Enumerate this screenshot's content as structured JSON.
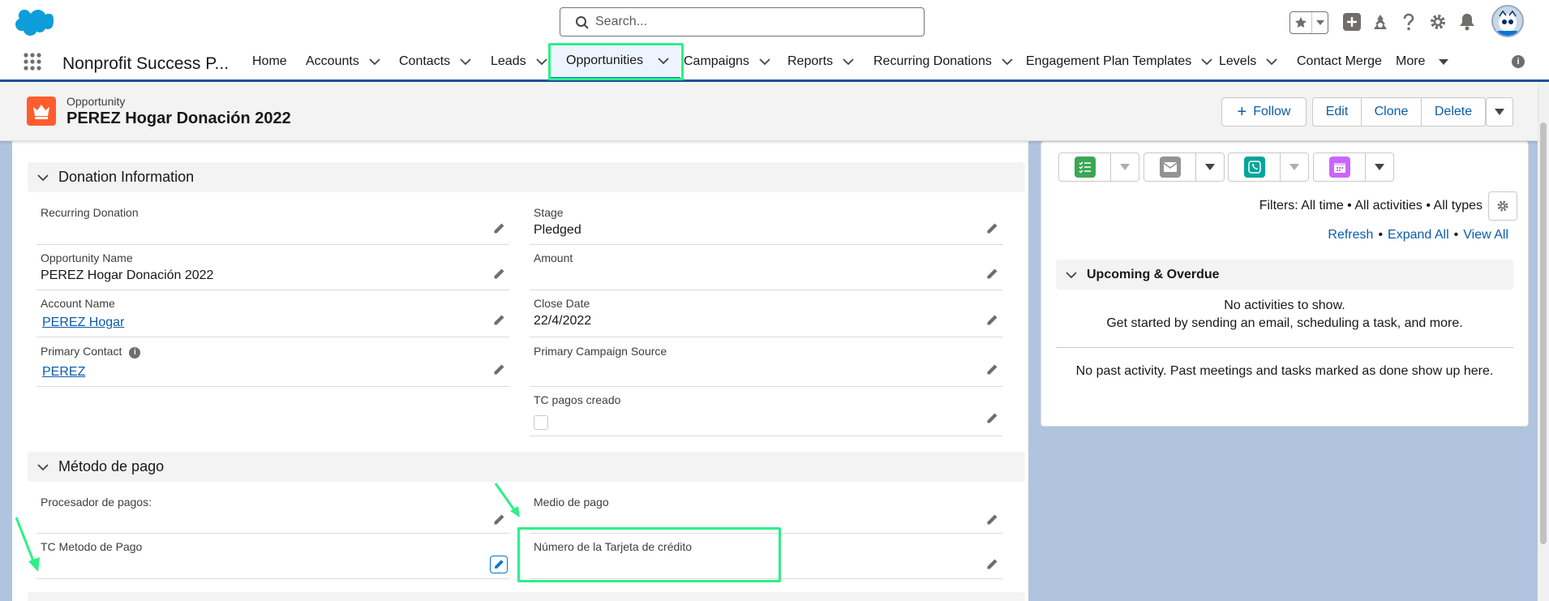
{
  "header": {
    "search_placeholder": "Search..."
  },
  "nav": {
    "app_name": "Nonprofit Success P...",
    "items": [
      {
        "label": "Home"
      },
      {
        "label": "Accounts"
      },
      {
        "label": "Contacts"
      },
      {
        "label": "Leads"
      },
      {
        "label": "Opportunities",
        "active": true
      },
      {
        "label": "Campaigns"
      },
      {
        "label": "Reports"
      },
      {
        "label": "Recurring Donations"
      },
      {
        "label": "Engagement Plan Templates"
      },
      {
        "label": "Levels"
      },
      {
        "label": "Contact Merge"
      },
      {
        "label": "More"
      }
    ]
  },
  "record": {
    "type": "Opportunity",
    "title": "PEREZ Hogar Donación 2022",
    "actions": {
      "follow": "Follow",
      "edit": "Edit",
      "clone": "Clone",
      "delete": "Delete"
    }
  },
  "donation_section": {
    "title": "Donation Information",
    "fields": {
      "recurring_donation": {
        "label": "Recurring Donation",
        "value": ""
      },
      "stage": {
        "label": "Stage",
        "value": "Pledged"
      },
      "opportunity_name": {
        "label": "Opportunity Name",
        "value": "PEREZ Hogar Donación 2022"
      },
      "amount": {
        "label": "Amount",
        "value": ""
      },
      "account_name": {
        "label": "Account Name",
        "value": "PEREZ Hogar"
      },
      "close_date": {
        "label": "Close Date",
        "value": "22/4/2022"
      },
      "primary_contact": {
        "label": "Primary Contact",
        "value": "PEREZ"
      },
      "primary_campaign_source": {
        "label": "Primary Campaign Source",
        "value": ""
      },
      "tc_pagos_creado": {
        "label": "TC pagos creado",
        "checked": false
      }
    }
  },
  "payment_section": {
    "title": "Método de pago",
    "fields": {
      "procesador": {
        "label": "Procesador de pagos:",
        "value": ""
      },
      "medio": {
        "label": "Medio de pago",
        "value": ""
      },
      "tc_metodo": {
        "label": "TC Metodo de Pago",
        "value": ""
      },
      "numero_tarjeta": {
        "label": "Número de la Tarjeta de crédito",
        "value": ""
      }
    }
  },
  "activity": {
    "filters": "Filters: All time • All activities • All types",
    "links": {
      "refresh": "Refresh",
      "expand": "Expand All",
      "view": "View All"
    },
    "upcoming_title": "Upcoming & Overdue",
    "no_activities": "No activities to show.",
    "get_started": "Get started by sending an email, scheduling a task, and more.",
    "no_past": "No past activity. Past meetings and tasks marked as done show up here.",
    "buttons": [
      {
        "icon": "task-icon",
        "color": "#3ba755"
      },
      {
        "icon": "email-icon",
        "color": "#939393"
      },
      {
        "icon": "call-icon",
        "color": "#06a59a"
      },
      {
        "icon": "event-icon",
        "color": "#cb65ff"
      }
    ]
  },
  "colors": {
    "highlight": "#2cf087",
    "brand": "#0176d3",
    "link": "#0b5cab",
    "opportunity_icon": "#ff5d2d"
  }
}
